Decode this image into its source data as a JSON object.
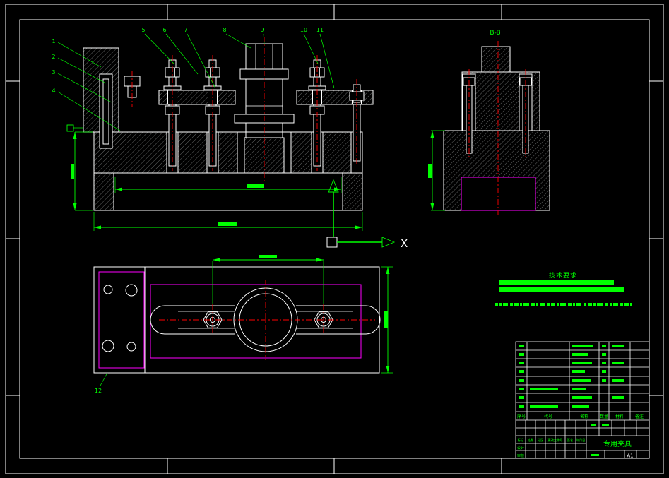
{
  "colors": {
    "background": "#000000",
    "white": "#ffffff",
    "green": "#00ff00",
    "red": "#ff0000",
    "magenta": "#ff00ff",
    "hatchline": "#b9bdbd"
  },
  "views": {
    "section_label": "B-B",
    "axis_label": "X"
  },
  "balloons": {
    "left": [
      "1",
      "2",
      "3",
      "4"
    ],
    "top": [
      "5",
      "6",
      "7",
      "8",
      "9",
      "10",
      "11"
    ],
    "plan": "12"
  },
  "tech_requirements": {
    "title": "技术要求"
  },
  "title_block": {
    "title": "专用夹具",
    "sheet_size": "A1",
    "bom_headers": [
      "序号",
      "代号",
      "名称",
      "数量",
      "材料",
      "备注"
    ],
    "revision_labels": [
      "标记",
      "处数",
      "分区",
      "更改文件号",
      "签名",
      "年月日"
    ],
    "role_labels": [
      "设计",
      "审核"
    ]
  }
}
